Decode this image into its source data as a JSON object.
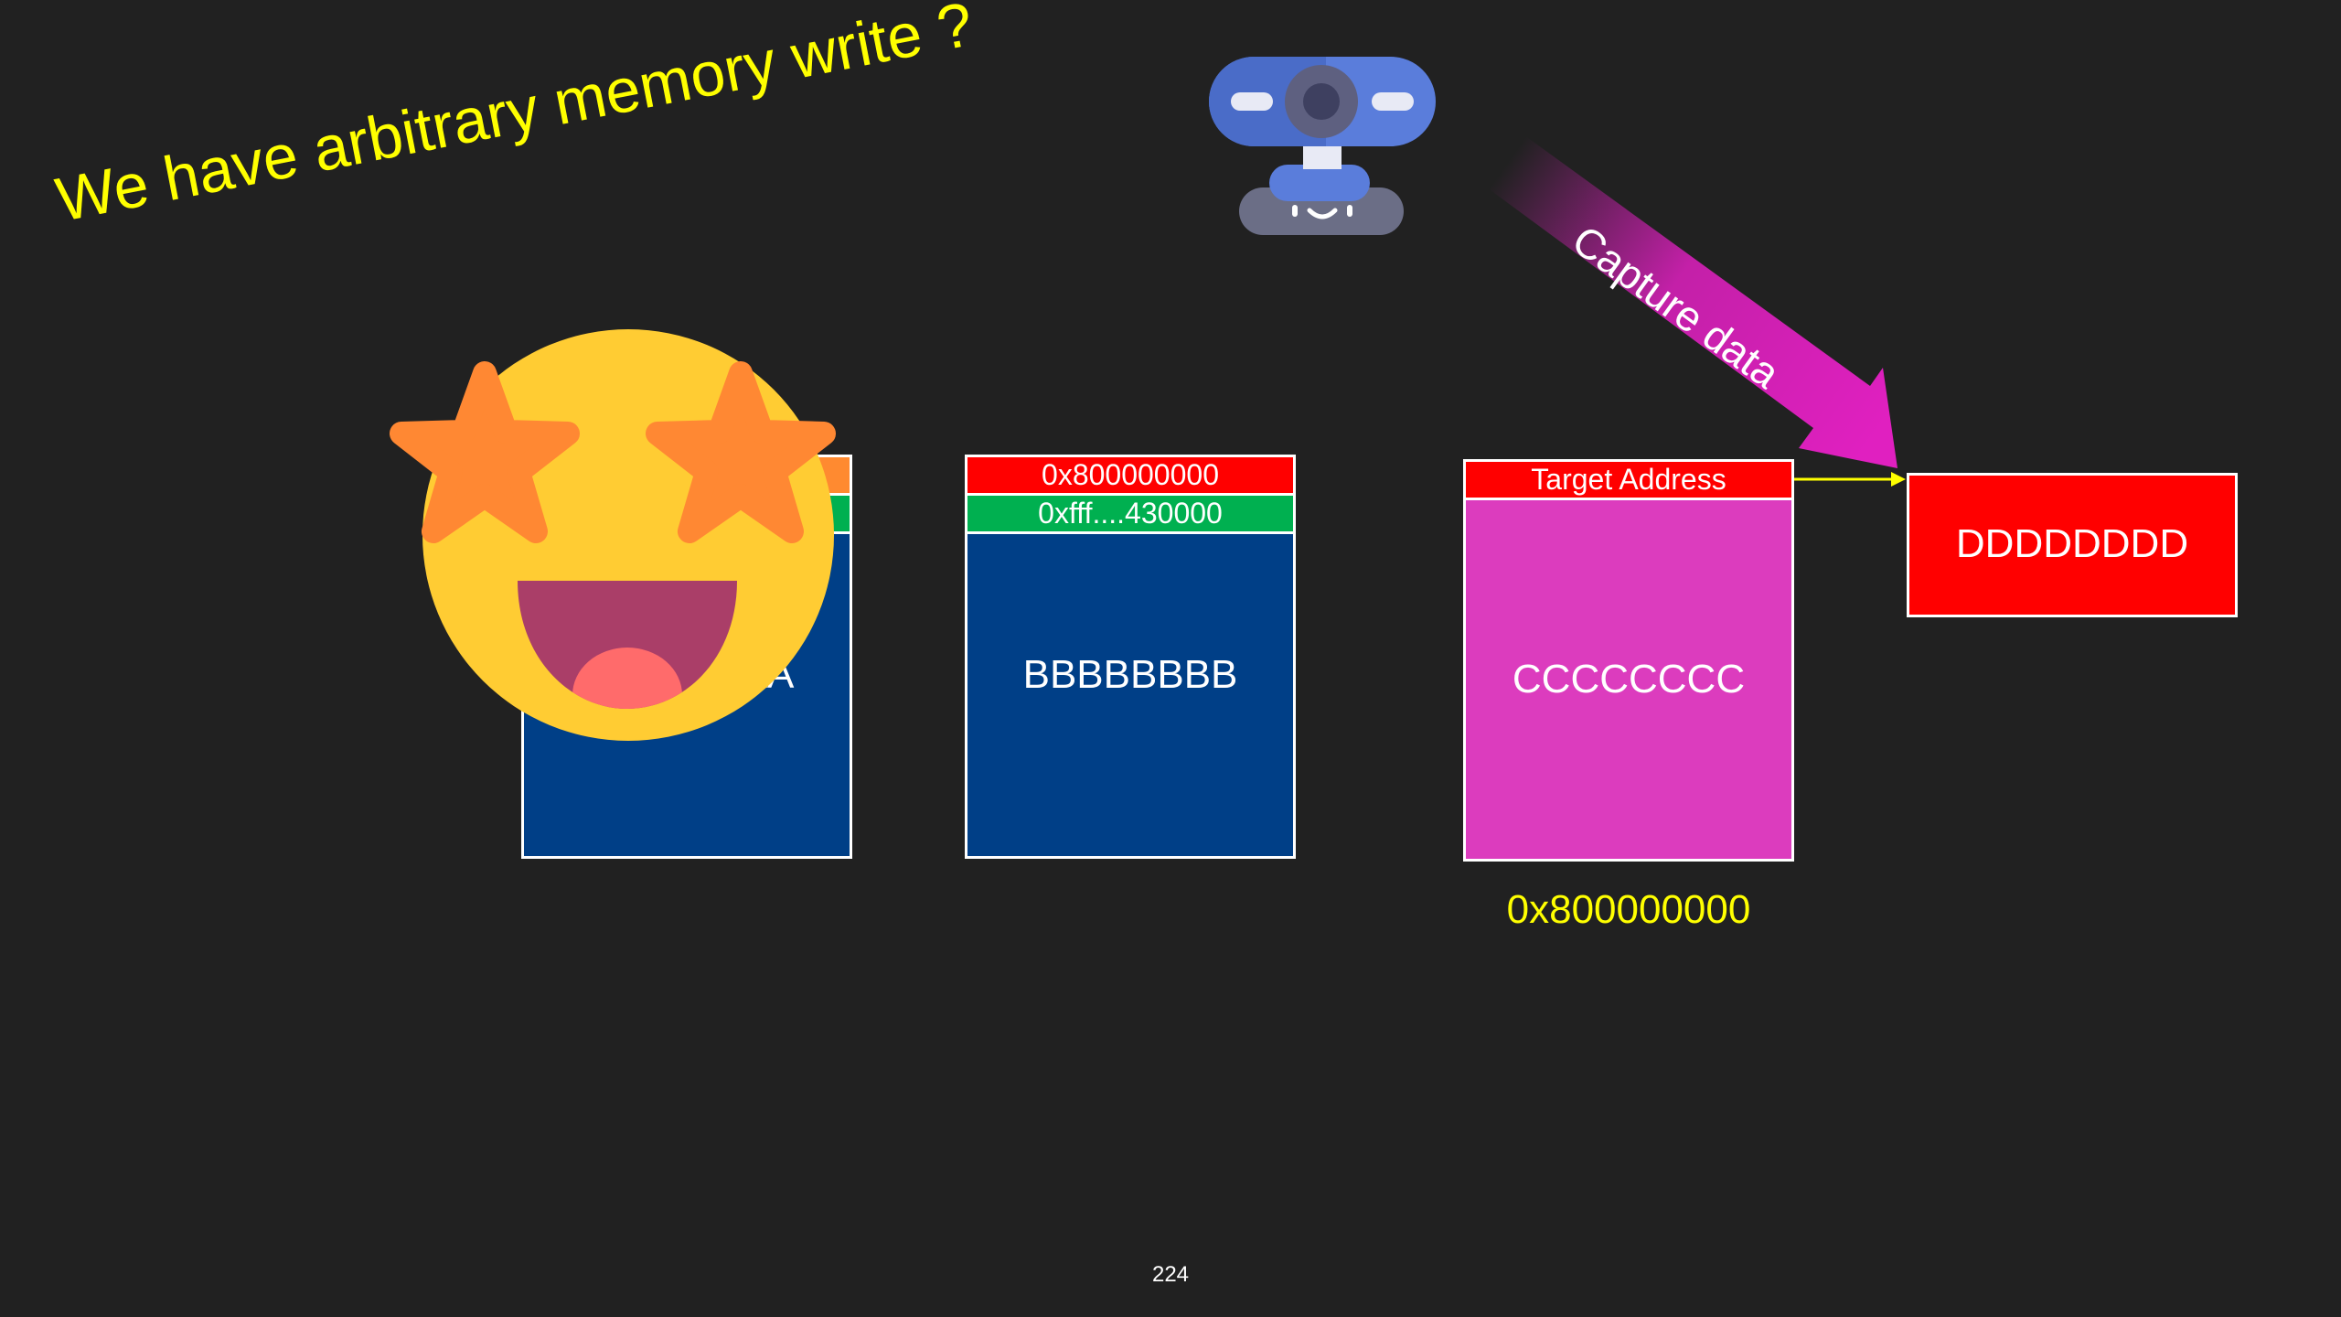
{
  "slide": {
    "title": "We have arbitrary memory write ?",
    "page_number": "224"
  },
  "chunks": {
    "a": {
      "body": "AAAAAAAA"
    },
    "b": {
      "header_top": "0x800000000",
      "header_bottom": "0xfff....430000",
      "body": "BBBBBBBB"
    },
    "c": {
      "header": "Target Address",
      "body": "CCCCCCCC",
      "address": "0x800000000"
    },
    "d": {
      "body": "DDDDDDDD"
    }
  },
  "arrow": {
    "label": "Capture data"
  },
  "icons": {
    "webcam": "webcam-icon",
    "emoji": "star-struck-emoji-icon"
  },
  "colors": {
    "background": "#212121",
    "title": "#FFFF00",
    "chunk_blue": "#003F87",
    "chunk_magenta": "#DC3CBE",
    "red": "#FF0000",
    "green": "#00B050",
    "arrow": "#E020C0"
  }
}
